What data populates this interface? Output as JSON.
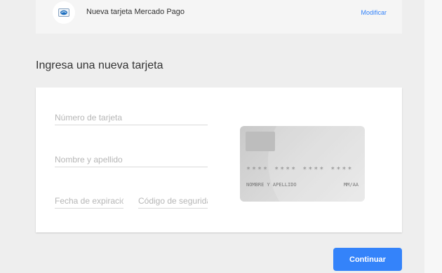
{
  "saved_method": {
    "logo_icon": "mercado-pago-card-icon",
    "name": "Nueva tarjeta Mercado Pago",
    "action_label": "Modificar"
  },
  "form": {
    "title": "Ingresa una nueva tarjeta",
    "card_number_placeholder": "Número de tarjeta",
    "name_placeholder": "Nombre y apellido",
    "expiry_placeholder": "Fecha de expiración",
    "cvv_placeholder": "Código de seguridad"
  },
  "card_preview": {
    "number_mask": "**** **** **** ****",
    "holder_placeholder": "NOMBRE Y APELLIDO",
    "expiry_placeholder": "MM/AA"
  },
  "actions": {
    "continue_label": "Continuar"
  },
  "colors": {
    "accent": "#3483fa",
    "background": "#eeeeee"
  }
}
